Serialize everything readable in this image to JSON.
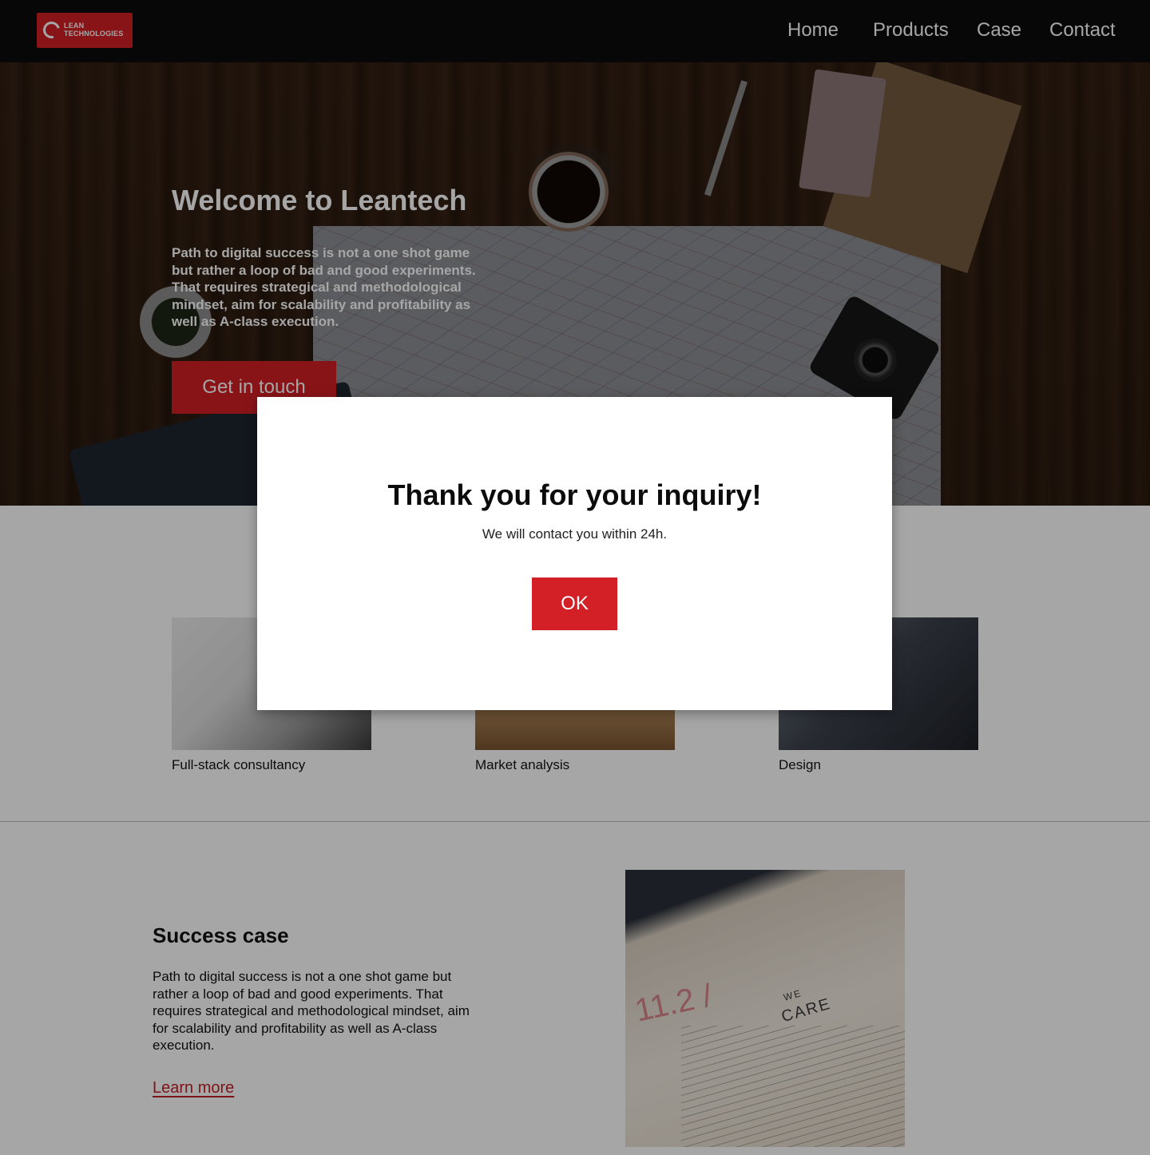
{
  "header": {
    "logo_line1": "LEAN",
    "logo_line2": "TECHNOLOGIES",
    "nav": {
      "home": "Home",
      "products": "Products",
      "case": "Case",
      "contact": "Contact"
    }
  },
  "hero": {
    "title": "Welcome to Leantech",
    "text": "Path to digital success is not a one shot game but rather a loop of bad and good experiments. That requires strategical and methodological mindset, aim for scalability and profitability as well as A-class execution.",
    "button": "Get in touch"
  },
  "services": {
    "items": [
      {
        "label": "Full-stack consultancy"
      },
      {
        "label": "Market analysis"
      },
      {
        "label": "Design"
      }
    ]
  },
  "case": {
    "title": "Success case",
    "text": "Path to digital success is not a one shot game but rather a loop of bad and good experiments. That requires strategical and methodological mindset, aim for scalability and profitability as well as A-class execution.",
    "link": "Learn more",
    "image_text": {
      "number": "11.2 /",
      "we": "WE",
      "care": "CARE"
    }
  },
  "modal": {
    "title": "Thank you for your inquiry!",
    "subtitle": "We will contact you within 24h.",
    "ok": "OK"
  },
  "colors": {
    "accent": "#d31f26",
    "header_bg": "#0b0b0b",
    "link": "#c21e24"
  }
}
